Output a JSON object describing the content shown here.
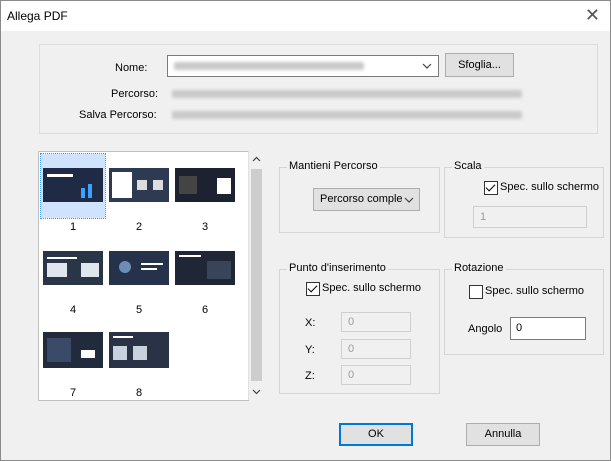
{
  "window": {
    "title": "Allega PDF",
    "close_glyph": "✕"
  },
  "file": {
    "name_label": "Nome:",
    "path_label": "Percorso:",
    "save_path_label": "Salva Percorso:",
    "browse_label": "Sfoglia..."
  },
  "pages": {
    "numbers": [
      "1",
      "2",
      "3",
      "4",
      "5",
      "6",
      "7",
      "8"
    ]
  },
  "keep_path": {
    "title": "Mantieni Percorso",
    "option": "Percorso comple"
  },
  "scale": {
    "title": "Scala",
    "specify_label": "Spec. sullo schermo",
    "checked": true,
    "value": "1"
  },
  "insertion": {
    "title": "Punto d'inserimento",
    "specify_label": "Spec. sullo schermo",
    "checked": true,
    "x_label": "X:",
    "y_label": "Y:",
    "z_label": "Z:",
    "x_value": "0",
    "y_value": "0",
    "z_value": "0"
  },
  "rotation": {
    "title": "Rotazione",
    "specify_label": "Spec. sullo schermo",
    "checked": false,
    "angle_label": "Angolo",
    "angle_value": "0"
  },
  "buttons": {
    "ok": "OK",
    "cancel": "Annulla"
  },
  "colors": {
    "accent": "#0078d7",
    "selection": "#3399ff"
  }
}
